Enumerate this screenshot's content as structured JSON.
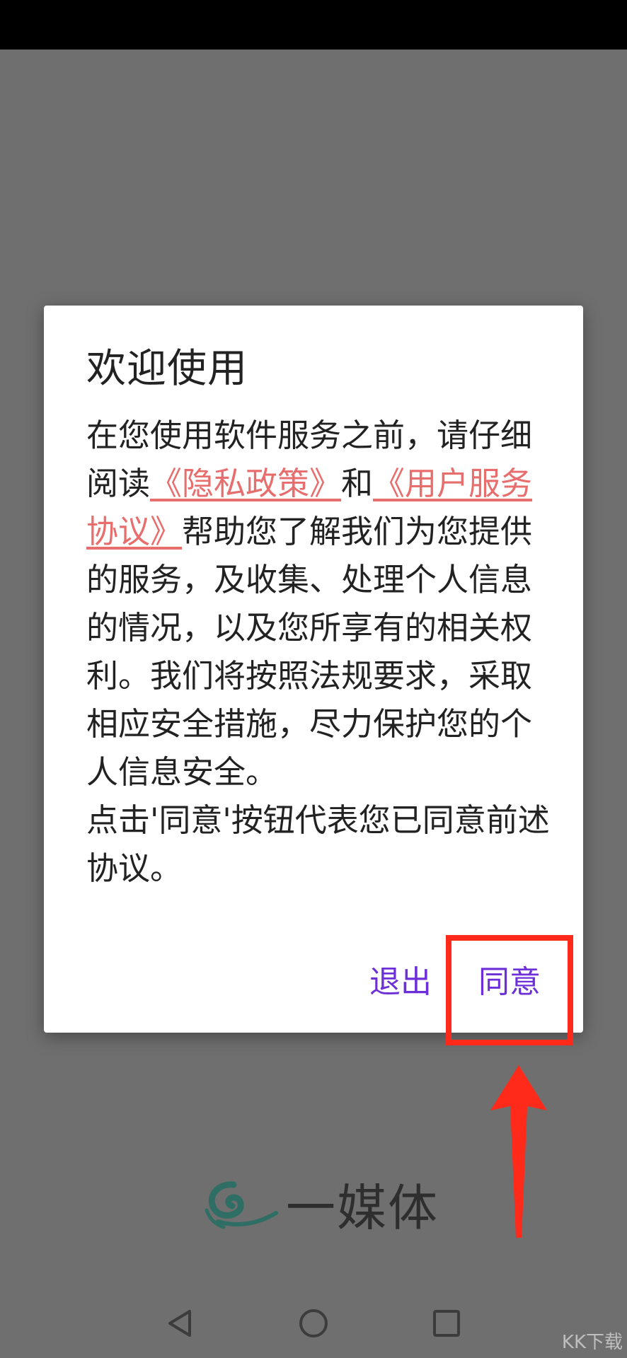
{
  "dialog": {
    "title": "欢迎使用",
    "body_prefix": "在您使用软件服务之前，请仔细阅读",
    "privacy_link": "《隐私政策》",
    "and_text": "和",
    "terms_link": "《用户服务协议》",
    "body_main": "帮助您了解我们为您提供的服务，及收集、处理个人信息的情况，以及您所享有的相关权利。我们将按照法规要求，采取相应安全措施，尽力保护您的个人信息安全。",
    "body_consent": "点击'同意'按钮代表您已同意前述协议。",
    "exit_label": "退出",
    "agree_label": "同意"
  },
  "brand": {
    "name": "一媒体"
  },
  "navbar": {
    "icons": [
      "back-icon",
      "home-icon",
      "recents-icon"
    ]
  },
  "watermark": {
    "text": "KK下载"
  },
  "colors": {
    "overlay": "#6f6f6f",
    "link": "#e86d6d",
    "button": "#6c2fd8",
    "highlight": "#ff2a1a",
    "logo": "#2f6e64"
  }
}
